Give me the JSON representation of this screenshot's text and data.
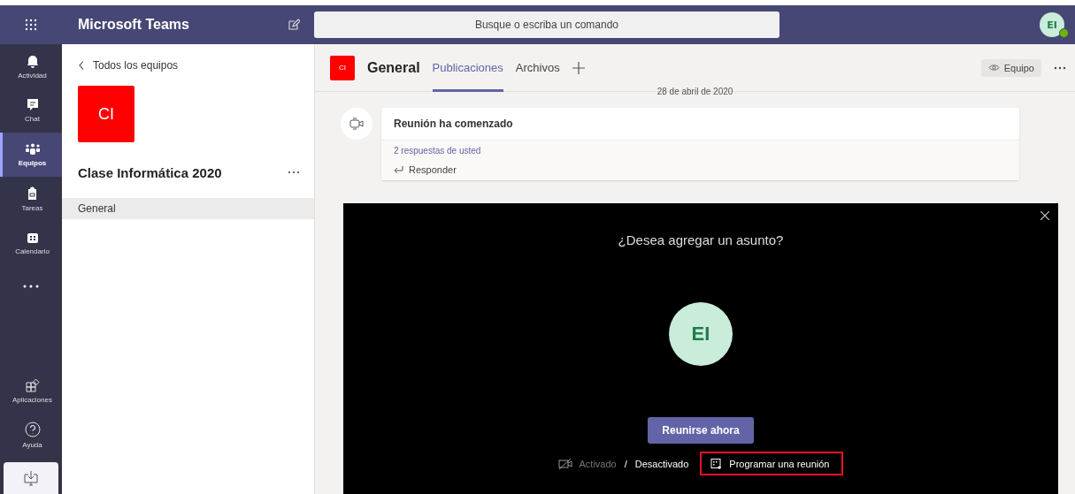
{
  "app": {
    "title": "Microsoft Teams",
    "search_placeholder": "Busque o escriba un comando",
    "avatar": "EI",
    "online": true
  },
  "rail": [
    {
      "label": "Actividad",
      "selected": false
    },
    {
      "label": "Chat",
      "selected": false
    },
    {
      "label": "Equipos",
      "selected": true
    },
    {
      "label": "Tareas",
      "selected": false
    },
    {
      "label": "Calendario",
      "selected": false
    }
  ],
  "rail_bottom": [
    {
      "label": "Aplicaciones"
    },
    {
      "label": "Ayuda"
    }
  ],
  "team_panel": {
    "back": "Todos los equipos",
    "team_initials": "CI",
    "team_name": "Clase Informática 2020",
    "channels": [
      {
        "name": "General",
        "selected": true
      }
    ]
  },
  "channel": {
    "initials": "CI",
    "name": "General",
    "tabs": [
      {
        "label": "Publicaciones",
        "selected": true
      },
      {
        "label": "Archivos",
        "selected": false
      }
    ],
    "team_button": "Equipo"
  },
  "date_divider": "28 de abril de 2020",
  "post": {
    "title": "Reunión ha comenzado",
    "replies": "2 respuestas de usted",
    "reply": "Responder"
  },
  "meeting": {
    "prompt": "¿Desea agregar un asunto?",
    "avatar": "EI",
    "join": "Reunirse ahora",
    "camera_options": [
      {
        "label": "Activado",
        "selected": false
      },
      {
        "label": "Desactivado",
        "selected": true
      }
    ],
    "separator": "/",
    "schedule": "Programar una reunión",
    "schedule_highlighted": true
  }
}
